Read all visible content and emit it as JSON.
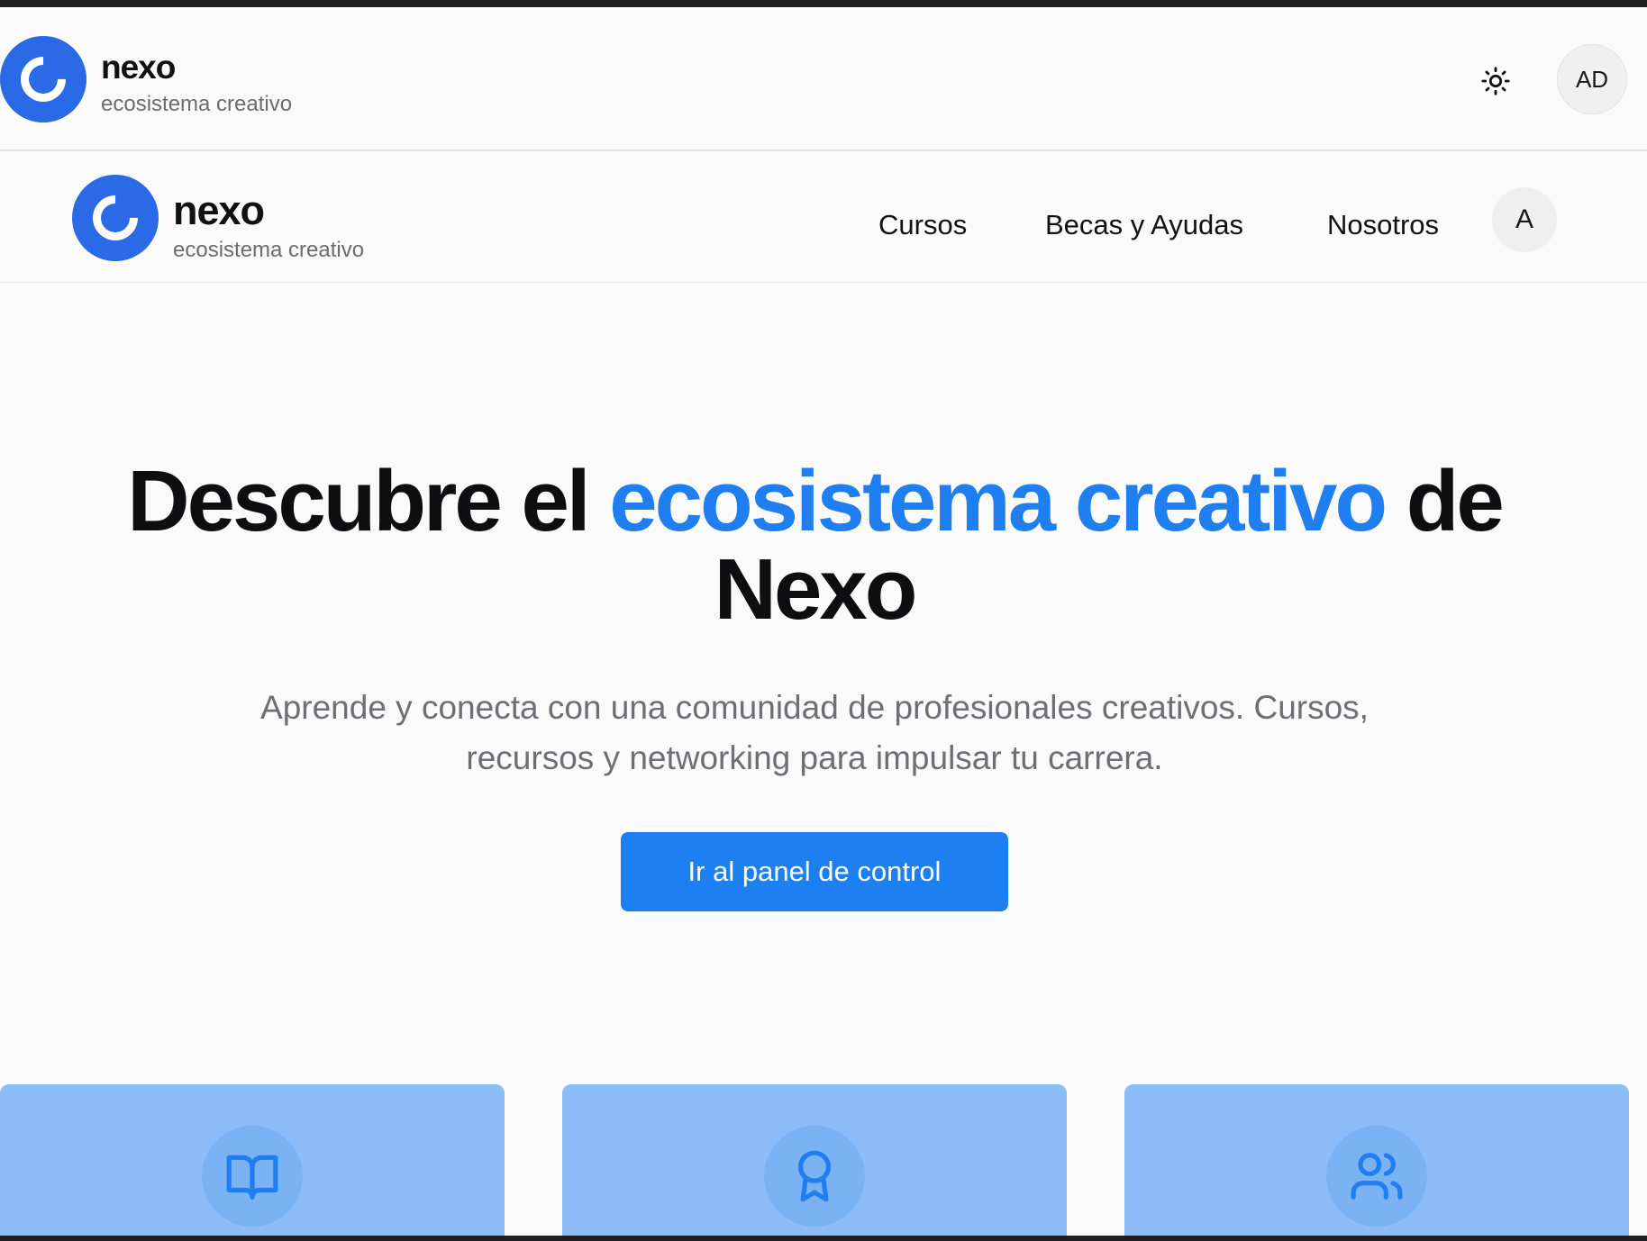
{
  "app_header": {
    "brand": {
      "name": "nexo",
      "tagline": "ecosistema creativo"
    },
    "theme_toggle_icon": "sun-icon",
    "avatar": "AD"
  },
  "site_nav": {
    "brand": {
      "name": "nexo",
      "tagline": "ecosistema creativo"
    },
    "links": [
      "Cursos",
      "Becas y Ayudas",
      "Nosotros"
    ],
    "avatar": "A"
  },
  "hero": {
    "title_part1": "Descubre el ",
    "title_accent": "ecosistema creativo",
    "title_part2": " de",
    "title_line2": "Nexo",
    "subtitle": "Aprende y conecta con una comunidad de profesionales creativos. Cursos, recursos y networking para impulsar tu carrera.",
    "cta_label": "Ir al panel de control"
  },
  "cards": [
    {
      "icon": "book-open-icon"
    },
    {
      "icon": "award-icon"
    },
    {
      "icon": "users-icon"
    }
  ],
  "colors": {
    "brand_blue": "#2a6ae6",
    "accent_blue": "#1f7ef0",
    "cta_blue": "#1c80f2",
    "card_blue": "#8cbdf8"
  }
}
